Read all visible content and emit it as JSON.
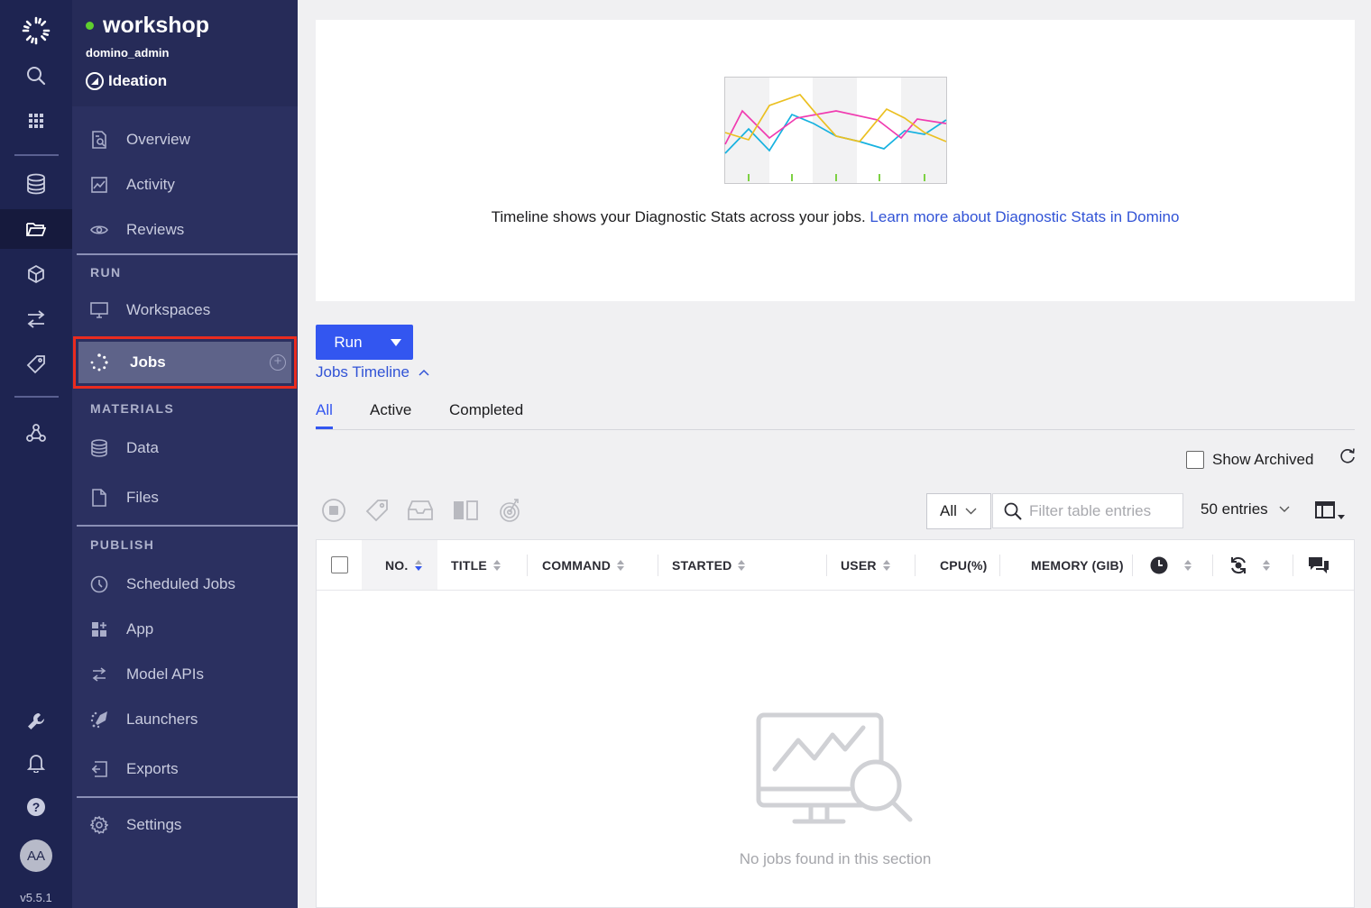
{
  "rail": {
    "icons": [
      "domino-logo-icon",
      "search-icon",
      "grid-icon",
      "database-icon",
      "folder-icon",
      "cube-icon",
      "swap-icon",
      "tag-icon",
      "network-icon",
      "wrench-icon",
      "bell-icon",
      "help-icon"
    ],
    "avatar": "AA",
    "version": "v5.5.1"
  },
  "project": {
    "name": "workshop",
    "owner": "domino_admin",
    "stage": "Ideation",
    "status_color": "#5fcf2e"
  },
  "sidebar": {
    "items": [
      {
        "label": "Overview",
        "icon": "overview-icon"
      },
      {
        "label": "Activity",
        "icon": "activity-icon"
      },
      {
        "label": "Reviews",
        "icon": "eye-icon"
      }
    ],
    "run_section": "RUN",
    "run_items": [
      {
        "label": "Workspaces",
        "icon": "monitor-icon"
      },
      {
        "label": "Jobs",
        "icon": "spinner-icon",
        "active": true
      }
    ],
    "materials_section": "MATERIALS",
    "materials_items": [
      {
        "label": "Data",
        "icon": "database-icon"
      },
      {
        "label": "Files",
        "icon": "file-icon"
      }
    ],
    "publish_section": "PUBLISH",
    "publish_items": [
      {
        "label": "Scheduled Jobs",
        "icon": "clock-icon"
      },
      {
        "label": "App",
        "icon": "app-icon"
      },
      {
        "label": "Model APIs",
        "icon": "swap-icon"
      },
      {
        "label": "Launchers",
        "icon": "launcher-icon"
      },
      {
        "label": "Exports",
        "icon": "export-icon"
      }
    ],
    "settings": {
      "label": "Settings",
      "icon": "gear-icon"
    }
  },
  "timeline": {
    "description": "Timeline shows your Diagnostic Stats across your jobs.",
    "link": "Learn more about Diagnostic Stats in Domino",
    "toggle_label": "Jobs Timeline"
  },
  "run_button": "Run",
  "tabs": [
    "All",
    "Active",
    "Completed"
  ],
  "active_tab": "All",
  "show_archived": "Show Archived",
  "filter": {
    "status_select": "All",
    "placeholder": "Filter table entries",
    "entries": "50 entries"
  },
  "table": {
    "columns": [
      "NO.",
      "TITLE",
      "COMMAND",
      "STARTED",
      "USER",
      "CPU(%)",
      "MEMORY (GIB)"
    ],
    "icon_columns": [
      "clock-icon",
      "status-sync-icon",
      "comments-icon"
    ],
    "empty_text": "No jobs found in this section"
  },
  "colors": {
    "rail": "#1e2451",
    "sidebar": "#2b3060",
    "accent": "#3356f0",
    "highlight_border": "#ea2b1f"
  }
}
